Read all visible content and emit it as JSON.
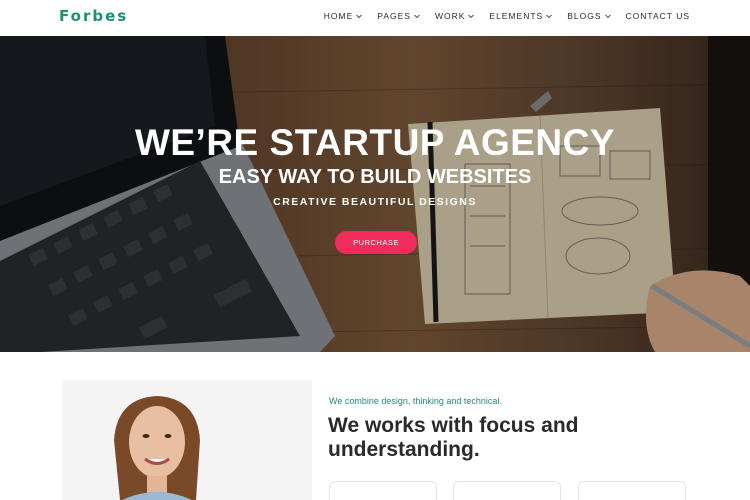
{
  "brand": {
    "name": "Forbes",
    "accent": "#1e8f72"
  },
  "nav": {
    "items": [
      {
        "label": "HOME",
        "has_dropdown": true
      },
      {
        "label": "PAGES",
        "has_dropdown": true
      },
      {
        "label": "WORK",
        "has_dropdown": true
      },
      {
        "label": "ELEMENTS",
        "has_dropdown": true
      },
      {
        "label": "BLOGS",
        "has_dropdown": true
      },
      {
        "label": "CONTACT US",
        "has_dropdown": false
      }
    ]
  },
  "hero": {
    "title": "WE’RE STARTUP AGENCY",
    "subtitle": "EASY WAY TO BUILD WEBSITES",
    "tagline": "CREATIVE BEAUTIFUL DESIGNS",
    "button_label": "PURCHASE",
    "button_color": "#ef2c5c"
  },
  "about": {
    "kicker": "We combine design, thinking and technical.",
    "heading": "We works with focus and understanding."
  }
}
